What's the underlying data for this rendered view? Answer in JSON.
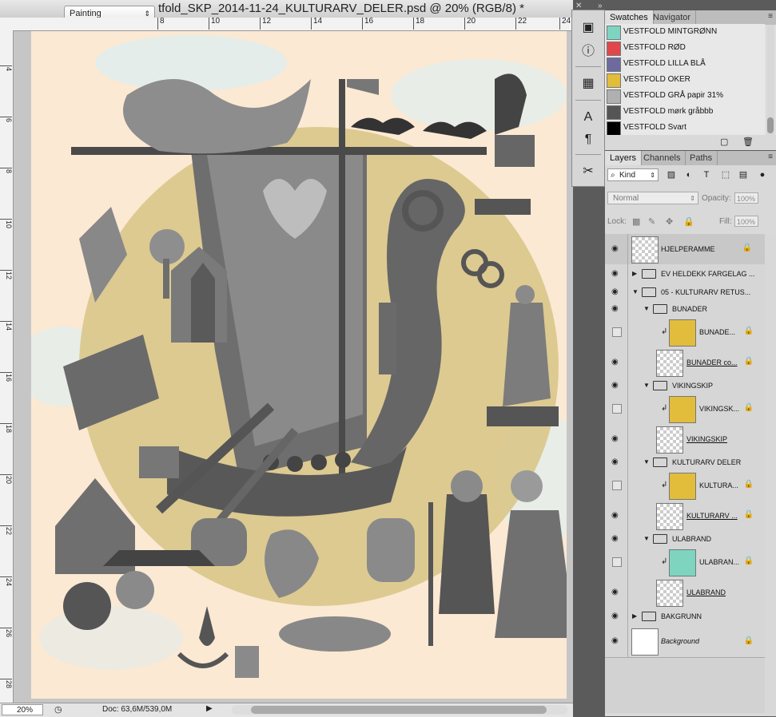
{
  "document": {
    "title": "tfold_SKP_2014-11-24_KULTURARV_DELER.psd @ 20% (RGB/8) *",
    "workspace": "Painting",
    "zoom": "20%",
    "doc_info": "Doc: 63,6M/539,0M"
  },
  "rulers": {
    "top": [
      "8",
      "10",
      "12",
      "14",
      "16",
      "18",
      "20",
      "22",
      "24"
    ],
    "left": [
      "4",
      "6",
      "8",
      "10",
      "12",
      "14",
      "16",
      "18",
      "20",
      "22",
      "24",
      "26",
      "28"
    ]
  },
  "panels": {
    "swatches_tab": "Swatches",
    "navigator_tab": "Navigator",
    "layers_tab": "Layers",
    "channels_tab": "Channels",
    "paths_tab": "Paths"
  },
  "swatches": [
    {
      "label": "VESTFOLD MINTGRØNN",
      "color": "#7fd4c0"
    },
    {
      "label": "VESTFOLD RØD",
      "color": "#e0474a"
    },
    {
      "label": "VESTFOLD LILLA BLÅ",
      "color": "#6d6a9e"
    },
    {
      "label": "VESTFOLD OKER",
      "color": "#e2bd3c"
    },
    {
      "label": "VESTFOLD GRÅ papir 31%",
      "color": "#b0b0b0"
    },
    {
      "label": "VESTFOLD  mørk gråbbb",
      "color": "#555555"
    },
    {
      "label": "VESTFOLD Svart",
      "color": "#000000"
    }
  ],
  "layers_panel": {
    "kind": "Kind",
    "blend_mode": "Normal",
    "opacity_label": "Opacity:",
    "opacity_value": "100%",
    "lock_label": "Lock:",
    "fill_label": "Fill:",
    "fill_value": "100%"
  },
  "layers": [
    {
      "name": "HJELPERAMME"
    },
    {
      "name": "EV HELDEKK FARGELAG ..."
    },
    {
      "name": "05 - KULTURARV RETUS..."
    },
    {
      "name": "BUNADER"
    },
    {
      "name": "BUNADE..."
    },
    {
      "name": "BUNADER co..."
    },
    {
      "name": "VIKINGSKIP"
    },
    {
      "name": "VIKINGSK..."
    },
    {
      "name": "VIKINGSKIP"
    },
    {
      "name": "KULTURARV DELER"
    },
    {
      "name": "KULTURA..."
    },
    {
      "name": "KULTURARV ..."
    },
    {
      "name": "ULABRAND"
    },
    {
      "name": "ULABRAN..."
    },
    {
      "name": "ULABRAND"
    },
    {
      "name": "BAKGRUNN"
    },
    {
      "name": "Background"
    }
  ],
  "colors": {
    "canvas_bg": "#fbe9d3",
    "ochre_circle": "#d9c68a",
    "thumb_yellow": "#e2bd3c",
    "thumb_mint": "#7fd4c0"
  },
  "icons": [
    "3d-icon",
    "info-icon",
    "paint-icon",
    "character-icon",
    "paragraph-icon",
    "tool-presets-icon"
  ]
}
